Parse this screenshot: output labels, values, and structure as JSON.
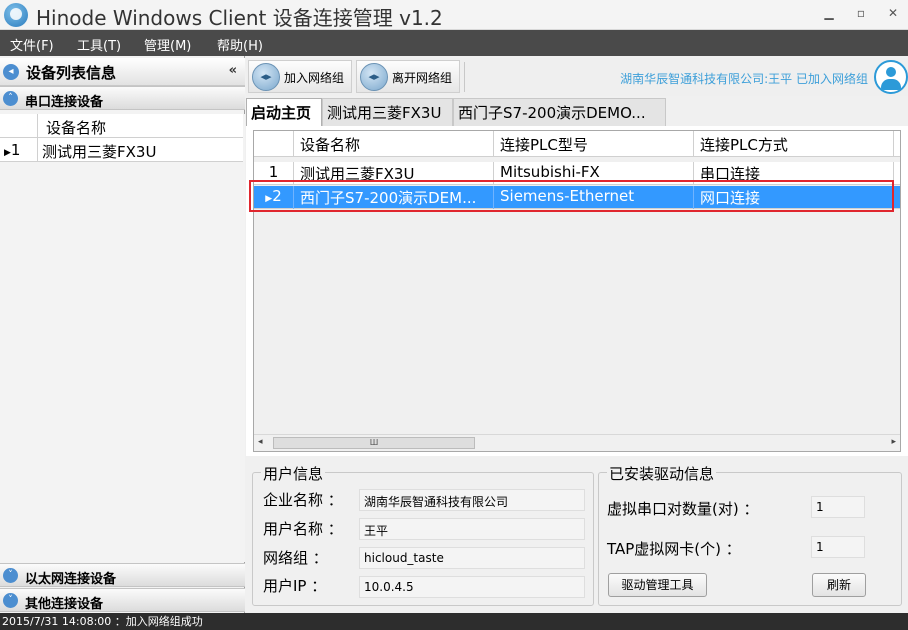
{
  "window": {
    "title": "Hinode Windows Client 设备连接管理 v1.2",
    "minimize": "▁",
    "restore": "▫",
    "close": "✕"
  },
  "menu": [
    "文件(F)",
    "工具(T)",
    "管理(M)",
    "帮助(H)"
  ],
  "left_panel": {
    "header": "设备列表信息",
    "collapse": "«",
    "serial_section": "串口连接设备",
    "grid_header": "设备名称",
    "rows": [
      {
        "index": "1",
        "name": "测试用三菱FX3U"
      }
    ],
    "ethernet_section": "以太网连接设备",
    "other_section": "其他连接设备"
  },
  "toolbar": {
    "join_label": "加入网络组",
    "leave_label": "离开网络组",
    "status": "湖南华辰智通科技有限公司:王平  已加入网络组"
  },
  "tabs": [
    "启动主页",
    "测试用三菱FX3U",
    "西门子S7-200演示DEMO..."
  ],
  "device_grid": {
    "columns": [
      "设备名称",
      "连接PLC型号",
      "连接PLC方式"
    ],
    "rows": [
      {
        "index": "1",
        "name": "测试用三菱FX3U",
        "model": "Mitsubishi-FX",
        "mode": "串口连接"
      },
      {
        "index": "2",
        "name": "西门子S7-200演示DEM...",
        "model": "Siemens-Ethernet",
        "mode": "网口连接"
      }
    ],
    "selected_row": 2,
    "scroll_left": "◂",
    "scroll_right": "▸",
    "scroll_thumb": "Ш"
  },
  "user_info": {
    "title": "用户信息",
    "company_label": "企业名称 ：",
    "company": "湖南华辰智通科技有限公司",
    "user_label": "用户名称 ：",
    "user": "王平",
    "group_label": "网络组    ：",
    "group": "hicloud_taste",
    "ip_label": "用户IP     ：",
    "ip": "10.0.4.5"
  },
  "driver_info": {
    "title": "已安装驱动信息",
    "serial_pairs_label": "虚拟串口对数量(对)  ：",
    "serial_pairs": "1",
    "tap_label": "TAP虚拟网卡(个) ：",
    "tap": "1",
    "tool_button": "驱动管理工具",
    "refresh_button": "刷新"
  },
  "status_bar": "2015/7/31 14:08:00  ：加入网络组成功",
  "colors": {
    "selection": "#3399ff",
    "highlight_border": "#e0262e",
    "menubar": "#4a4a4a",
    "status_text": "#3d9fd9"
  }
}
